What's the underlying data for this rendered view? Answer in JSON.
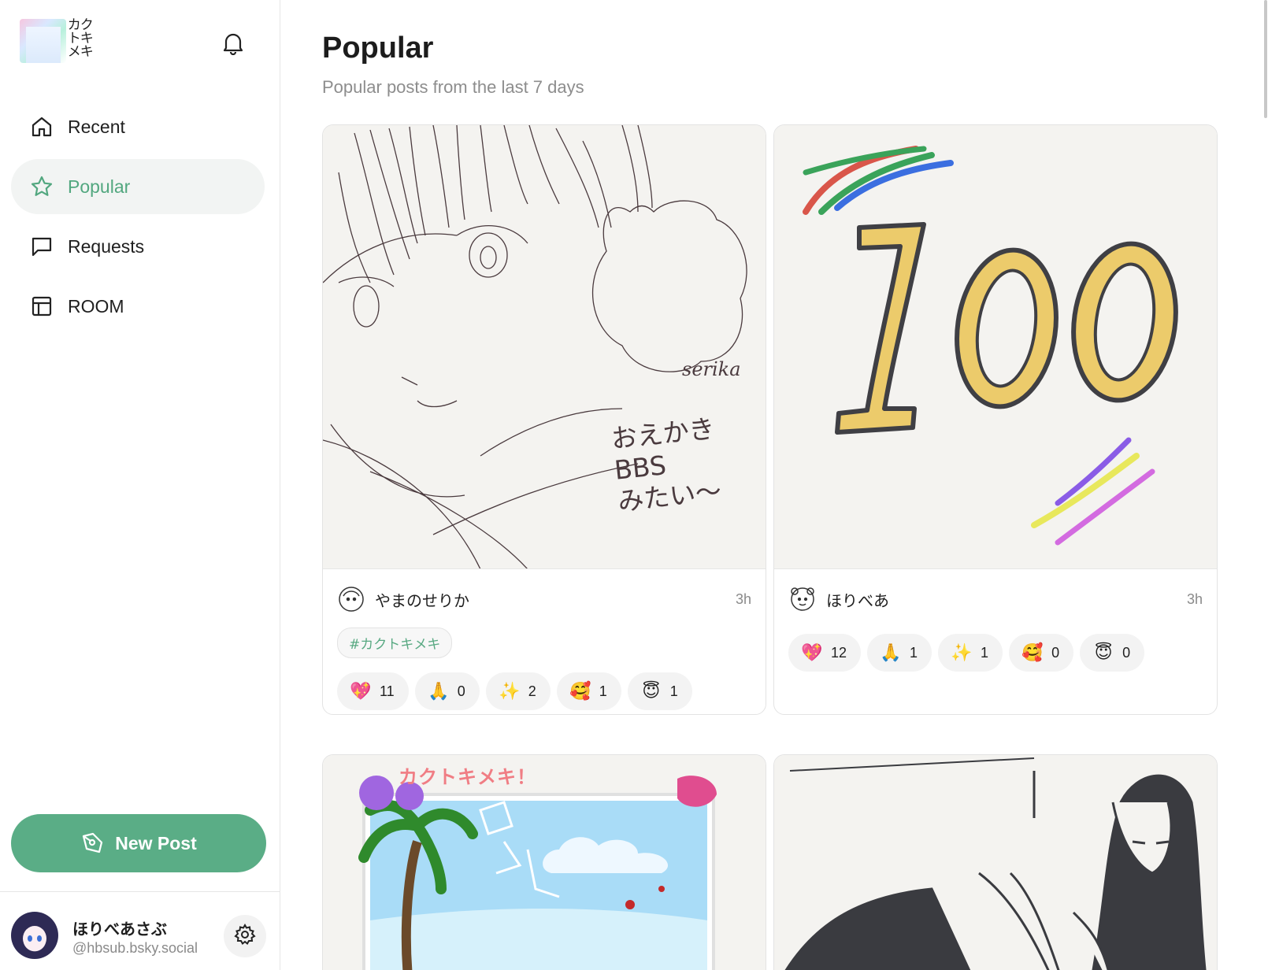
{
  "app": {
    "logo_text": "カクトキメキ"
  },
  "sidebar": {
    "items": [
      {
        "label": "Recent",
        "icon": "home-icon",
        "active": false
      },
      {
        "label": "Popular",
        "icon": "star-icon",
        "active": true
      },
      {
        "label": "Requests",
        "icon": "chat-bubble-icon",
        "active": false
      },
      {
        "label": "ROOM",
        "icon": "layout-icon",
        "active": false
      }
    ],
    "new_post_label": "New Post"
  },
  "user": {
    "display_name": "ほりべあさぶ",
    "handle": "@hbsub.bsky.social"
  },
  "main": {
    "title": "Popular",
    "subtitle": "Popular posts from the last 7 days"
  },
  "posts": [
    {
      "author": "やまのせりか",
      "time": "3h",
      "tag": "#カクトキメキ",
      "image_text": [
        "おえかき",
        "BBS",
        "みたい〜",
        "serika"
      ],
      "reactions": [
        {
          "emoji": "💖",
          "count": "11"
        },
        {
          "emoji": "🙏",
          "count": "0"
        },
        {
          "emoji": "✨",
          "count": "2"
        },
        {
          "emoji": "🥰",
          "count": "1"
        },
        {
          "emoji": "😇",
          "count": "1"
        }
      ]
    },
    {
      "author": "ほりべあ",
      "time": "3h",
      "image_text": [
        "100"
      ],
      "reactions": [
        {
          "emoji": "💖",
          "count": "12"
        },
        {
          "emoji": "🙏",
          "count": "1"
        },
        {
          "emoji": "✨",
          "count": "1"
        },
        {
          "emoji": "🥰",
          "count": "0"
        },
        {
          "emoji": "😇",
          "count": "0"
        }
      ]
    },
    {
      "image_text": [
        "カクトキメキ！"
      ]
    },
    {}
  ],
  "colors": {
    "accent": "#5aad86",
    "accent_text": "#52a77f"
  }
}
